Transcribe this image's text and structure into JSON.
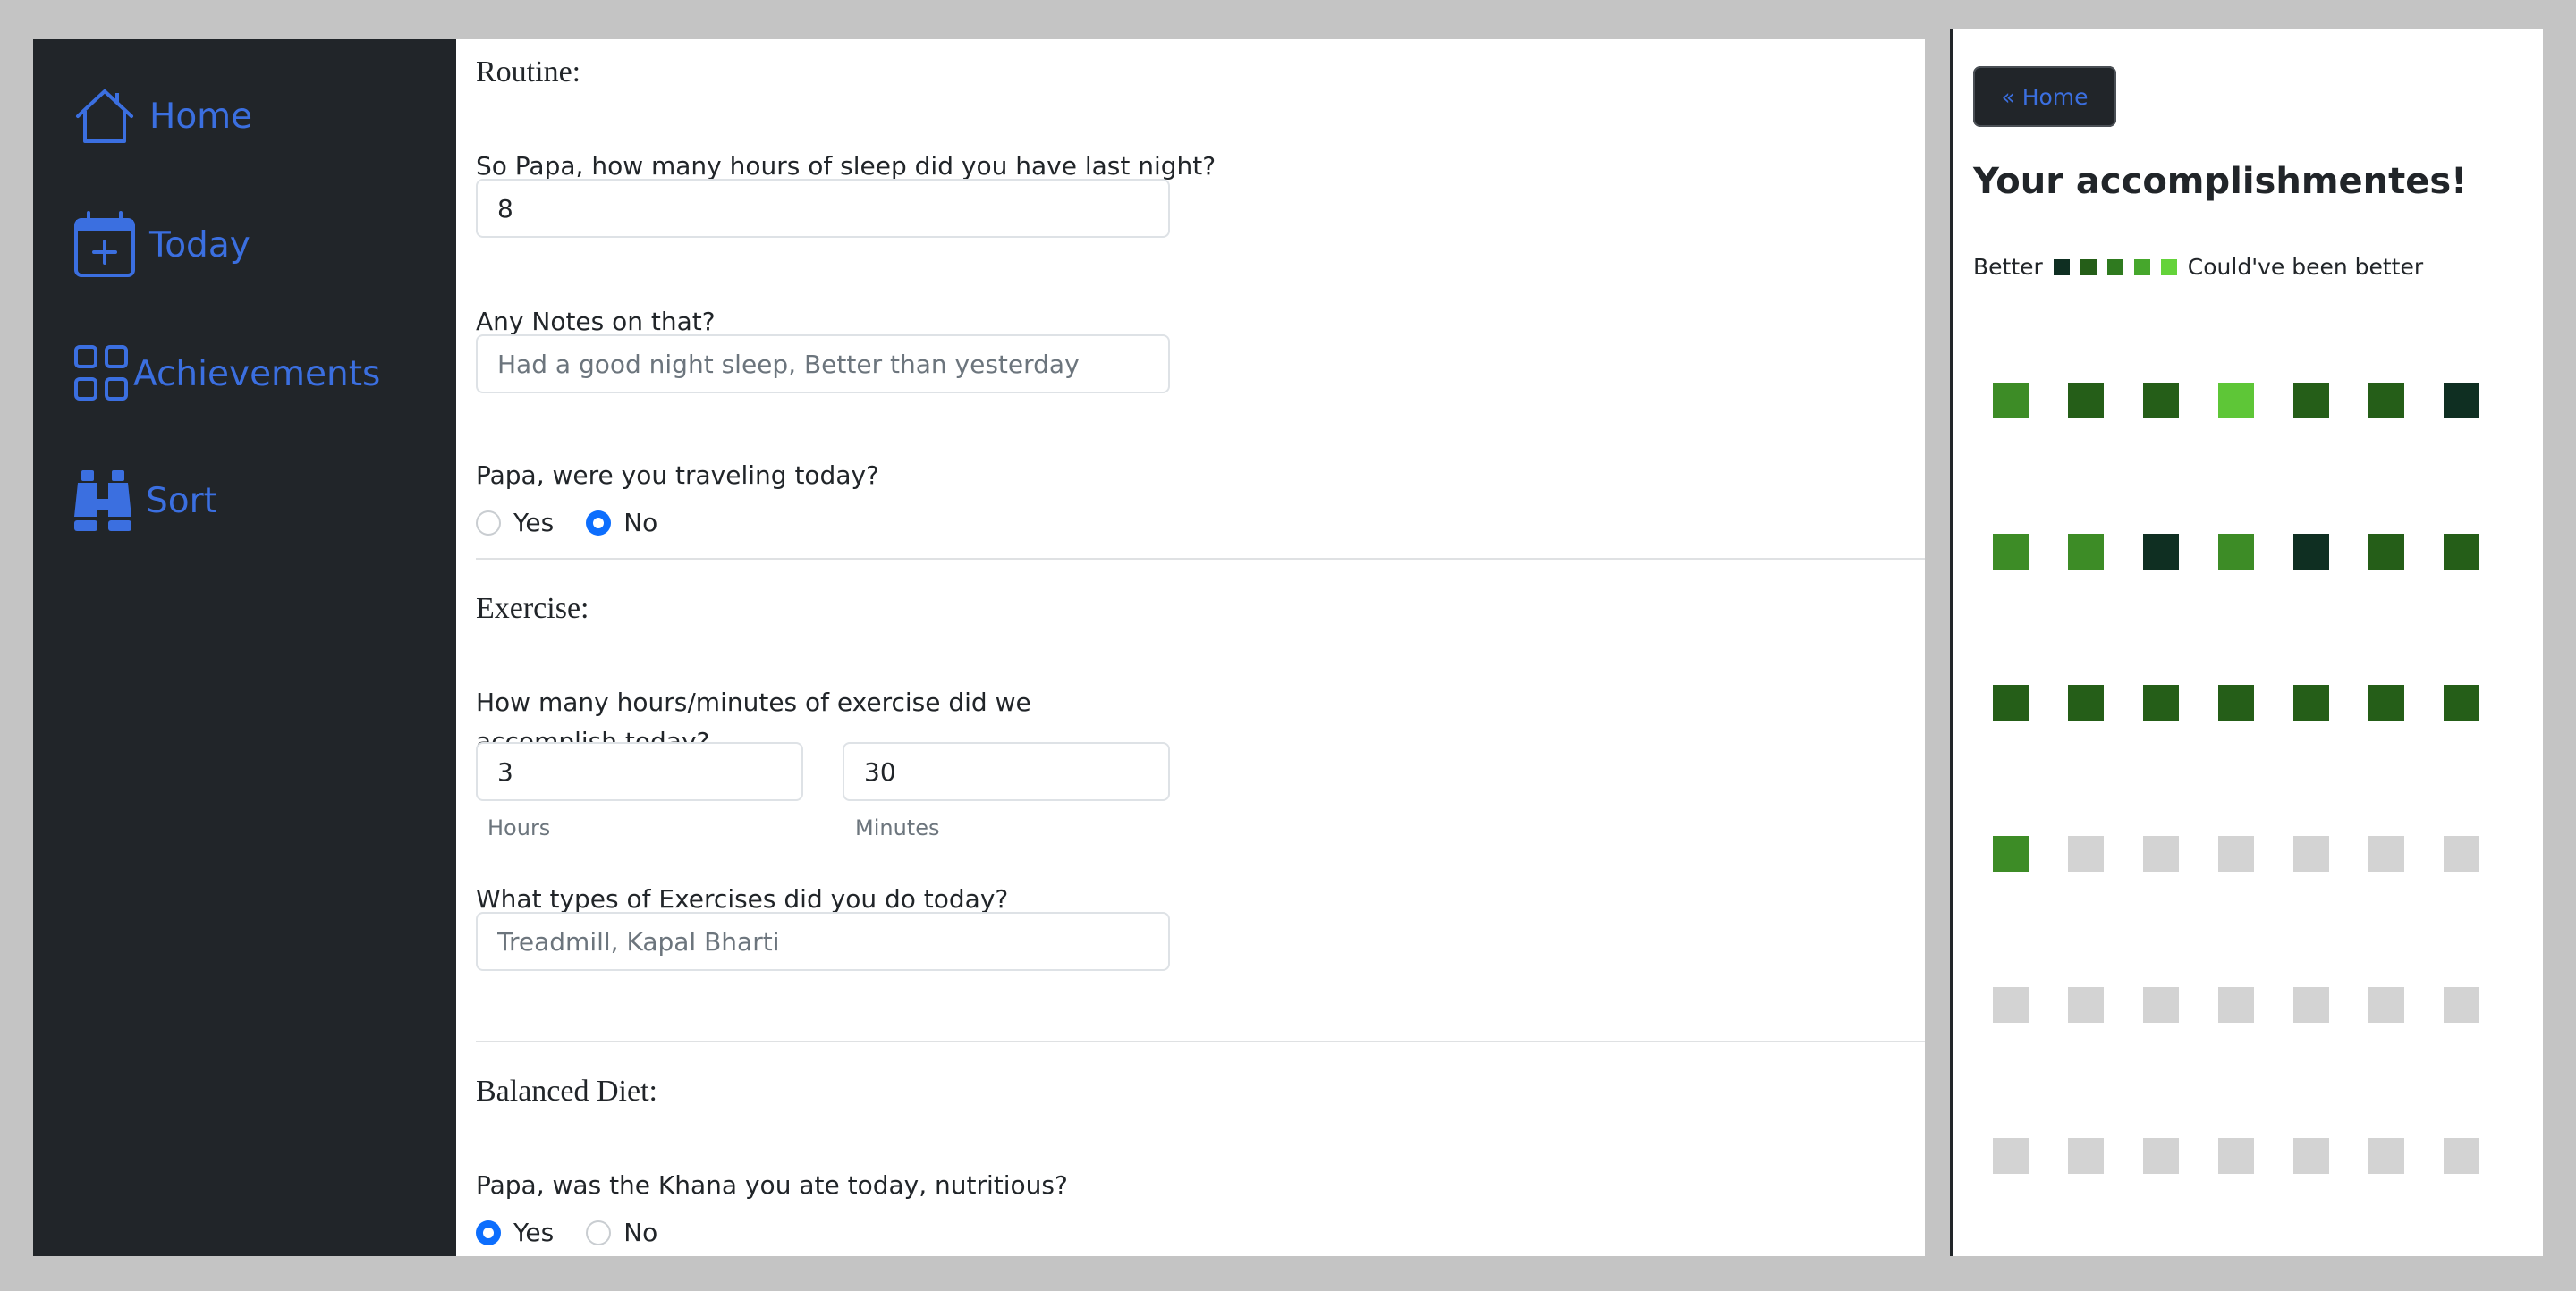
{
  "sidebar": {
    "items": [
      {
        "label": "Home",
        "icon": "home-icon"
      },
      {
        "label": "Today",
        "icon": "calendar-plus-icon"
      },
      {
        "label": "Achievements",
        "icon": "grid-icon"
      },
      {
        "label": "Sort",
        "icon": "binoculars-icon"
      }
    ]
  },
  "routine": {
    "title": "Routine:",
    "sleep_question": "So Papa, how many hours of sleep did you have last night?",
    "sleep_value": "8",
    "notes_question": "Any Notes on that?",
    "notes_placeholder": "Had a good night sleep, Better than yesterday",
    "travel_question": "Papa, were you traveling today?",
    "travel_options": [
      "Yes",
      "No"
    ],
    "travel_selected": "No"
  },
  "exercise": {
    "title": "Exercise:",
    "duration_question": "How many hours/minutes of exercise did we accomplish today?",
    "hours_value": "3",
    "minutes_value": "30",
    "hours_label": "Hours",
    "minutes_label": "Minutes",
    "types_question": "What types of Exercises did you do today?",
    "types_placeholder": "Treadmill, Kapal Bharti"
  },
  "diet": {
    "title": "Balanced Diet:",
    "nutritious_question": "Papa, was the Khana you ate today, nutritious?",
    "nutritious_options": [
      "Yes",
      "No"
    ],
    "nutritious_selected": "Yes"
  },
  "panel": {
    "home_button": "« Home",
    "title": "Your accomplishmentes!",
    "legend_better": "Better",
    "legend_worse": "Could've been better",
    "legend_colors": [
      "#0f2f22",
      "#255e18",
      "#2f7a1f",
      "#46a72c",
      "#64d33a"
    ]
  },
  "accent_color": "#3b6fe0",
  "chart_data": {
    "type": "heatmap",
    "rows": 6,
    "cols": 7,
    "levels": [
      [
        2,
        1,
        1,
        4,
        1,
        1,
        0
      ],
      [
        2,
        2,
        0,
        2,
        0,
        1,
        1
      ],
      [
        1,
        1,
        1,
        1,
        1,
        1,
        1
      ],
      [
        2,
        null,
        null,
        null,
        null,
        null,
        null
      ],
      [
        null,
        null,
        null,
        null,
        null,
        null,
        null
      ],
      [
        null,
        null,
        null,
        null,
        null,
        null,
        null
      ]
    ],
    "palette": [
      "#0f2f22",
      "#255e18",
      "#3d8c26",
      "#46a72c",
      "#5ec637"
    ],
    "empty_color": "#d3d3d3"
  }
}
